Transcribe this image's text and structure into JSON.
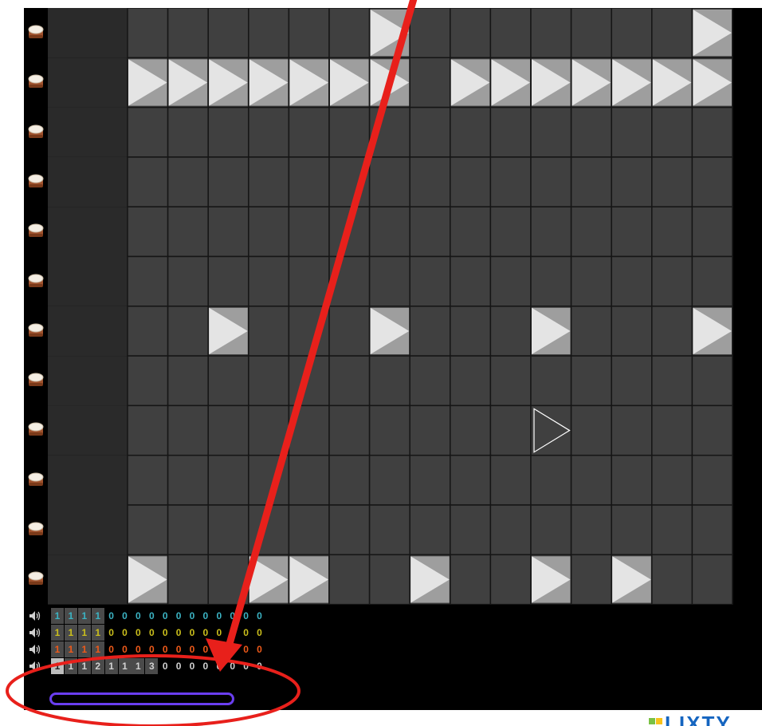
{
  "sequencer": {
    "drum_icon": "drum-icon",
    "rows": 12,
    "columns": 16,
    "active_cells": [
      [
        0,
        7
      ],
      [
        0,
        15
      ],
      [
        1,
        1
      ],
      [
        1,
        2
      ],
      [
        1,
        3
      ],
      [
        1,
        4
      ],
      [
        1,
        5
      ],
      [
        1,
        6
      ],
      [
        1,
        7
      ],
      [
        1,
        9
      ],
      [
        1,
        10
      ],
      [
        1,
        11
      ],
      [
        1,
        12
      ],
      [
        1,
        13
      ],
      [
        1,
        14
      ],
      [
        1,
        15
      ],
      [
        6,
        3
      ],
      [
        6,
        7
      ],
      [
        6,
        11
      ],
      [
        6,
        15
      ],
      [
        11,
        1
      ],
      [
        11,
        4
      ],
      [
        11,
        5
      ],
      [
        11,
        8
      ],
      [
        11,
        11
      ],
      [
        11,
        13
      ]
    ],
    "playhead": {
      "row": 8,
      "col": 11
    }
  },
  "counters": {
    "speaker_icon": "speaker-icon",
    "rows": [
      {
        "color": "#3bb3c3",
        "values": [
          "1",
          "1",
          "1",
          "1",
          "0",
          "0",
          "0",
          "0",
          "0",
          "0",
          "0",
          "0",
          "0",
          "0",
          "0",
          "0"
        ],
        "filled": 4,
        "first_highlight": false
      },
      {
        "color": "#cbbf1c",
        "values": [
          "1",
          "1",
          "1",
          "1",
          "0",
          "0",
          "0",
          "0",
          "0",
          "0",
          "0",
          "0",
          "0",
          "0",
          "0",
          "0"
        ],
        "filled": 4,
        "first_highlight": false
      },
      {
        "color": "#ef5a1a",
        "values": [
          "1",
          "1",
          "1",
          "1",
          "0",
          "0",
          "0",
          "0",
          "0",
          "0",
          "0",
          "0",
          "0",
          "0",
          "0",
          "0"
        ],
        "filled": 4,
        "first_highlight": false
      },
      {
        "color": "#d0d0d0",
        "values": [
          "1",
          "1",
          "1",
          "2",
          "1",
          "1",
          "1",
          "3",
          "0",
          "0",
          "0",
          "0",
          "0",
          "0",
          "0",
          "0"
        ],
        "filled": 8,
        "first_highlight": true
      }
    ]
  },
  "colors": {
    "annotation": "#e8201b",
    "slider_border": "#6a3ef0",
    "cell_dark": "#404040",
    "label_column": "#2a2a2a"
  },
  "logo": {
    "text": "LIXTY"
  }
}
